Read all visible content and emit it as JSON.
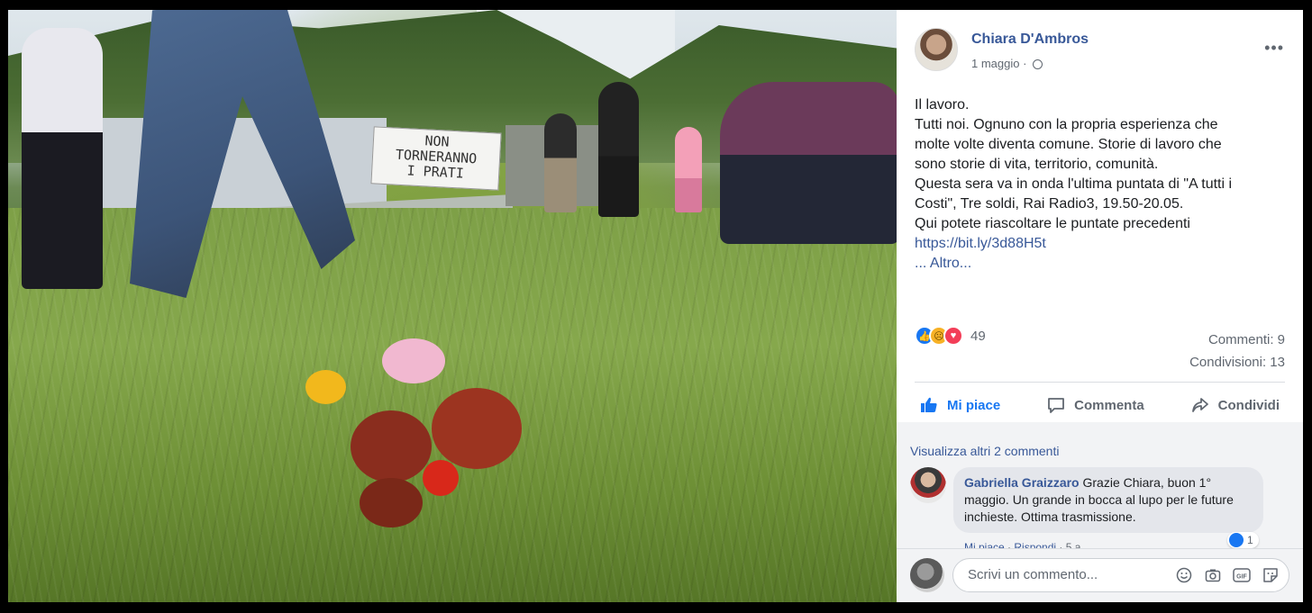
{
  "photo": {
    "banner_text_line1": "NON",
    "banner_text_line2": "TORNERANNO",
    "banner_text_line3": "I PRATI",
    "top_cut_text": "Chiara D'Ambros"
  },
  "post": {
    "author": "Chiara D'Ambros",
    "date": "1 maggio",
    "more_menu": "•••",
    "text_lines": [
      "Il lavoro.",
      "Tutti noi. Ognuno con la propria esperienza che",
      "molte volte diventa comune. Storie di lavoro che",
      "sono storie di vita, territorio, comunità.",
      "Questa sera va in onda l'ultima puntata di \"A tutti i",
      "Costi\", Tre soldi, Rai Radio3, 19.50-20.05.",
      "Qui potete riascoltare le puntate precedenti"
    ],
    "link": "https://bit.ly/3d88H5t",
    "see_more": "... Altro..."
  },
  "stats": {
    "reactions_count": "49",
    "comments": "Commenti: 9",
    "shares": "Condivisioni: 13"
  },
  "actions": {
    "like": "Mi piace",
    "comment": "Commenta",
    "share": "Condividi"
  },
  "comments": {
    "view_more": "Visualizza altri 2 commenti",
    "items": [
      {
        "name": "Gabriella Graizzaro",
        "text": " Grazie Chiara, buon 1° maggio. Un grande in bocca al lupo per le future inchieste. Ottima trasmissione.",
        "like_count": "1",
        "like_link": "Mi piace",
        "reply_link": "Rispondi",
        "age": "5 a"
      }
    ]
  },
  "composer": {
    "placeholder": "Scrivi un commento...",
    "gif_label": "GIF"
  },
  "colors": {
    "link": "#385898",
    "accent": "#1877f2",
    "muted": "#606770",
    "bubble": "#e4e6eb"
  }
}
